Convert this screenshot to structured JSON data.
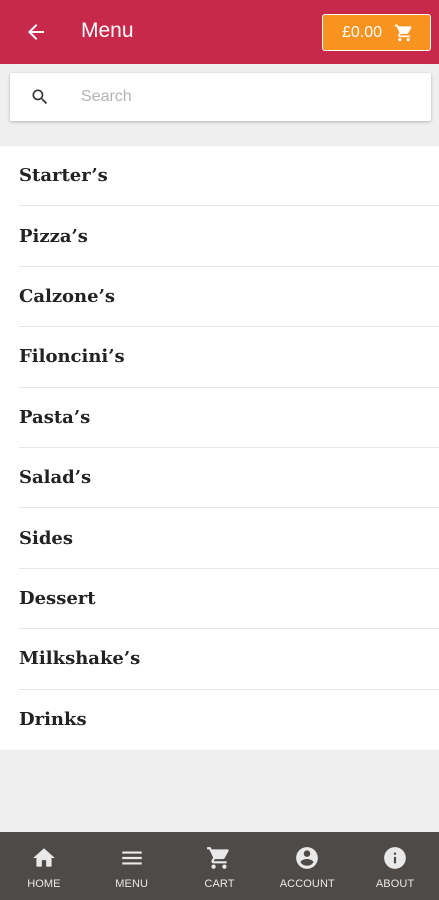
{
  "header": {
    "title": "Menu",
    "back_icon": "arrow-left-icon",
    "cart_amount": "£0.00",
    "cart_icon": "shopping-cart-icon"
  },
  "search": {
    "placeholder": "Search",
    "value": "",
    "icon": "search-icon"
  },
  "menu": {
    "items": [
      {
        "label": "Starter’s"
      },
      {
        "label": "Pizza’s"
      },
      {
        "label": "Calzone’s"
      },
      {
        "label": "Filoncini’s"
      },
      {
        "label": "Pasta’s"
      },
      {
        "label": "Salad’s"
      },
      {
        "label": "Sides"
      },
      {
        "label": "Dessert"
      },
      {
        "label": "Milkshake’s"
      },
      {
        "label": "Drinks"
      }
    ]
  },
  "bottom_nav": {
    "items": [
      {
        "label": "HOME",
        "icon": "home-icon"
      },
      {
        "label": "MENU",
        "icon": "menu-icon"
      },
      {
        "label": "CART",
        "icon": "shopping-cart-icon"
      },
      {
        "label": "ACCOUNT",
        "icon": "account-icon"
      },
      {
        "label": "ABOUT",
        "icon": "info-icon"
      }
    ]
  },
  "colors": {
    "header_bg": "#c8284a",
    "cart_button_bg": "#f7931e",
    "bottom_nav_bg": "#4e4a48",
    "page_bg": "#efeff0"
  }
}
